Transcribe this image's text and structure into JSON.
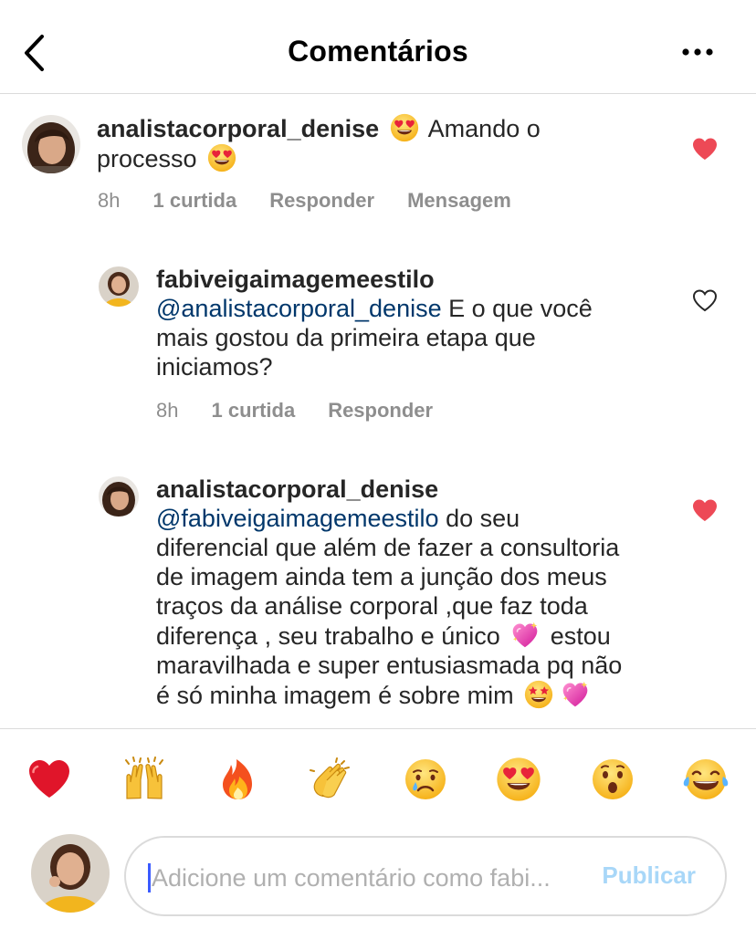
{
  "header": {
    "title": "Comentários"
  },
  "comments": [
    {
      "username": "analistacorporal_denise",
      "text_a": " Amando o",
      "text_b": "processo ",
      "time": "8h",
      "likes": "1 curtida",
      "reply": "Responder",
      "message": "Mensagem",
      "liked": true
    },
    {
      "username": "fabiveigaimagemeestilo",
      "mention": "@analistacorporal_denise",
      "text_l1": " E o que você",
      "text_l2": "mais gostou da primeira etapa que",
      "text_l3": "iniciamos?",
      "time": "8h",
      "likes": "1 curtida",
      "reply": "Responder",
      "liked": false
    },
    {
      "username": "analistacorporal_denise",
      "mention": "@fabiveigaimagemeestilo",
      "text_l1": " do seu",
      "text_l2": "diferencial que além de fazer a consultoria",
      "text_l3": "de imagem ainda tem a junção dos meus",
      "text_l4": "traços da análise corporal ,que faz toda",
      "text_l5a": "diferença , seu trabalho e único ",
      "text_l5b": " estou",
      "text_l6": "maravilhada e super entusiasmada pq não",
      "text_l7": "é só minha imagem é sobre mim ",
      "liked": true
    }
  ],
  "reactions": [
    "heart",
    "raised-hands",
    "fire",
    "clapping-hands",
    "crying-face",
    "heart-eyes-face",
    "surprised-face",
    "tears-of-joy-face"
  ],
  "composer": {
    "placeholder": "Adicione um comentário como fabi...",
    "publish_label": "Publicar"
  },
  "colors": {
    "like_red": "#ed4956",
    "mention_blue": "#00376b",
    "publish_disabled": "#a8d7f8",
    "meta_gray": "#8e8e8e"
  }
}
